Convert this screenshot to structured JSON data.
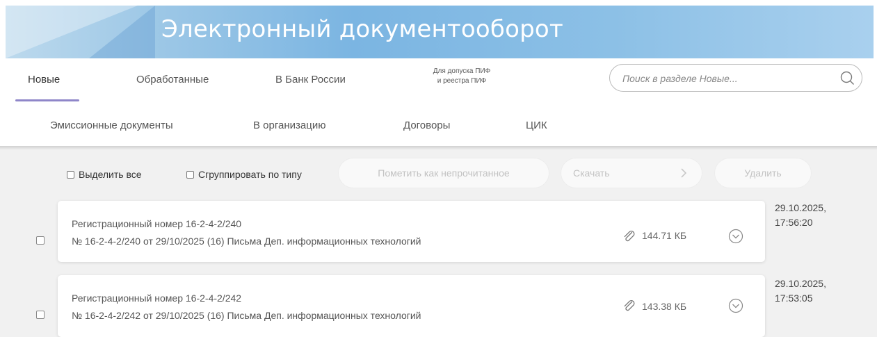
{
  "app": {
    "title": "Электронный документооборот"
  },
  "tabs_primary": [
    {
      "label": "Новые",
      "active": true
    },
    {
      "label": "Обработанные"
    },
    {
      "label": "В Банк России"
    },
    {
      "label_line1": "Для допуска ПИФ",
      "label_line2": "и реестра ПИФ"
    }
  ],
  "tabs_secondary": [
    {
      "label": "Эмиссионные документы"
    },
    {
      "label": "В организацию"
    },
    {
      "label": "Договоры"
    },
    {
      "label": "ЦИК"
    }
  ],
  "search": {
    "placeholder": "Поиск в разделе Новые..."
  },
  "toolbar": {
    "select_all": "Выделить все",
    "group_by_type": "Сгруппировать по типу",
    "mark_unread": "Пометить как непрочитанное",
    "download": "Скачать",
    "delete": "Удалить"
  },
  "documents": [
    {
      "title": "Регистрационный номер 16-2-4-2/240",
      "description": "№ 16-2-4-2/240 от 29/10/2025 (16) Письма Деп. информационных технологий",
      "size": "144.71 КБ",
      "date": "29.10.2025,",
      "time": "17:56:20"
    },
    {
      "title": "Регистрационный номер 16-2-4-2/242",
      "description": "№ 16-2-4-2/242 от 29/10/2025 (16) Письма Деп. информационных технологий",
      "size": "143.38 КБ",
      "date": "29.10.2025,",
      "time": "17:53:05"
    }
  ],
  "colors": {
    "accent_underline": "#8f86c9",
    "banner": "#7bb5e2"
  }
}
